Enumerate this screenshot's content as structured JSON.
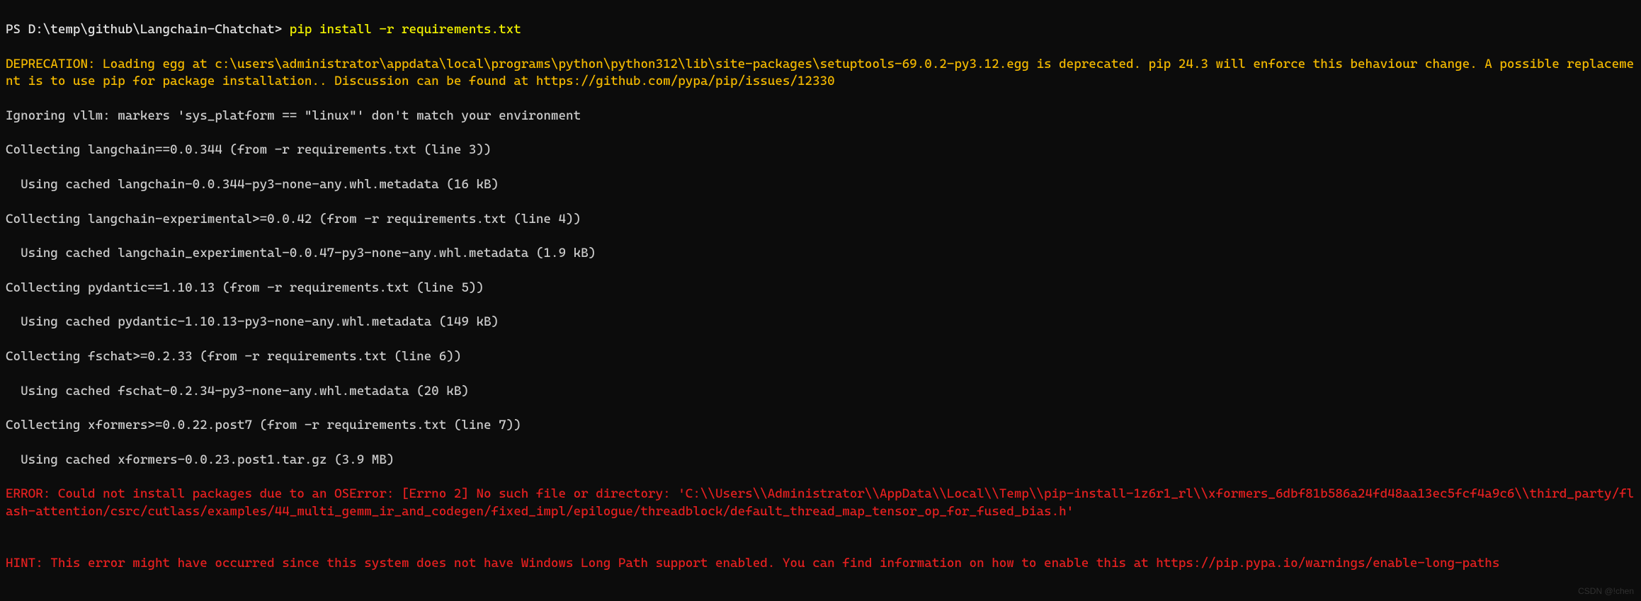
{
  "prompt": {
    "ps": "PS ",
    "path": "D:\\temp\\github\\Langchain-Chatchat",
    "gt": "> ",
    "command": "pip install -r requirements.txt"
  },
  "deprecation": "DEPRECATION: Loading egg at c:\\users\\administrator\\appdata\\local\\programs\\python\\python312\\lib\\site-packages\\setuptools-69.0.2-py3.12.egg is deprecated. pip 24.3 will enforce this behaviour change. A possible replacement is to use pip for package installation.. Discussion can be found at https://github.com/pypa/pip/issues/12330",
  "lines": [
    "Ignoring vllm: markers 'sys_platform == \"linux\"' don't match your environment",
    "Collecting langchain==0.0.344 (from -r requirements.txt (line 3))",
    "  Using cached langchain-0.0.344-py3-none-any.whl.metadata (16 kB)",
    "Collecting langchain-experimental>=0.0.42 (from -r requirements.txt (line 4))",
    "  Using cached langchain_experimental-0.0.47-py3-none-any.whl.metadata (1.9 kB)",
    "Collecting pydantic==1.10.13 (from -r requirements.txt (line 5))",
    "  Using cached pydantic-1.10.13-py3-none-any.whl.metadata (149 kB)",
    "Collecting fschat>=0.2.33 (from -r requirements.txt (line 6))",
    "  Using cached fschat-0.2.34-py3-none-any.whl.metadata (20 kB)",
    "Collecting xformers>=0.0.22.post7 (from -r requirements.txt (line 7))",
    "  Using cached xformers-0.0.23.post1.tar.gz (3.9 MB)"
  ],
  "error": "ERROR: Could not install packages due to an OSError: [Errno 2] No such file or directory: 'C:\\\\Users\\\\Administrator\\\\AppData\\\\Local\\\\Temp\\\\pip-install-1z6r1_rl\\\\xformers_6dbf81b586a24fd48aa13ec5fcf4a9c6\\\\third_party/flash-attention/csrc/cutlass/examples/44_multi_gemm_ir_and_codegen/fixed_impl/epilogue/threadblock/default_thread_map_tensor_op_for_fused_bias.h'",
  "blank": "",
  "hint": "HINT: This error might have occurred since this system does not have Windows Long Path support enabled. You can find information on how to enable this at https://pip.pypa.io/warnings/enable-long-paths",
  "watermark": "CSDN @!chen"
}
